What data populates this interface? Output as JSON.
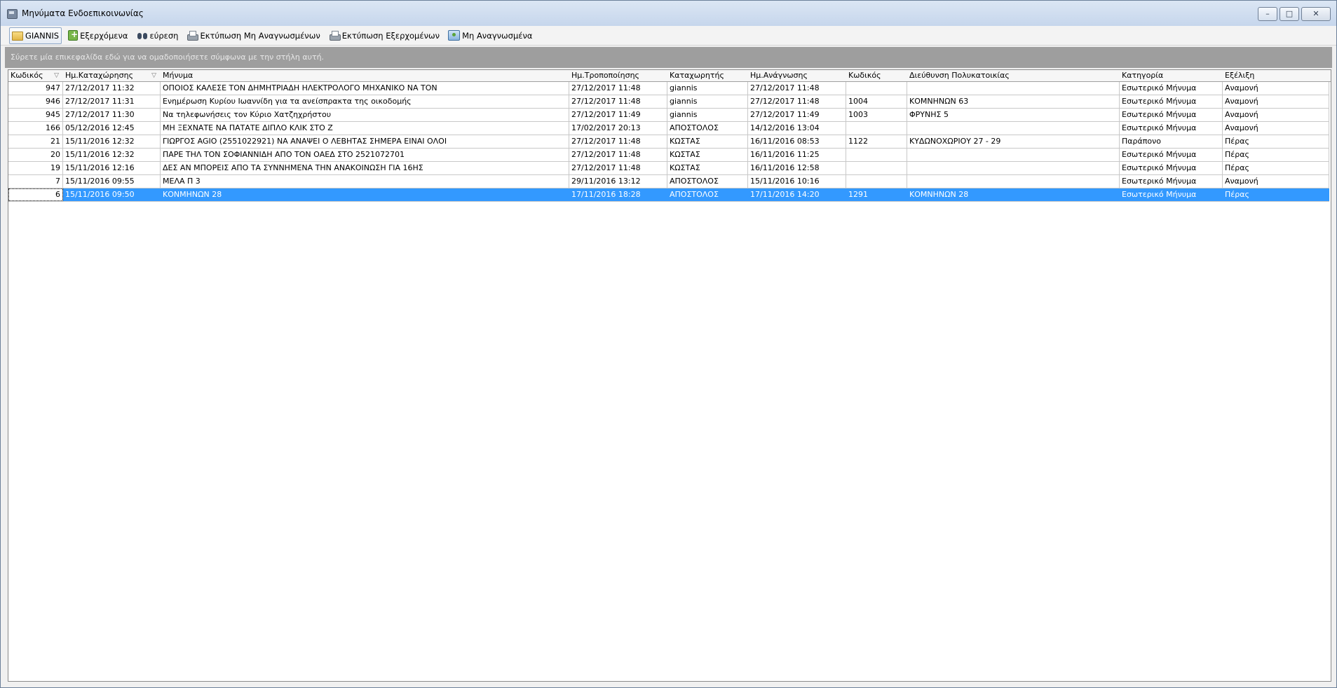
{
  "window": {
    "title": "Μηνύματα Ενδοεπικοινωνίας",
    "controls": {
      "minimize": "–",
      "maximize": "□",
      "close": "✕"
    }
  },
  "toolbar": {
    "items": [
      {
        "label": "GIANNIS",
        "icon": "folder-icon"
      },
      {
        "label": "Εξερχόμενα",
        "icon": "export-icon"
      },
      {
        "label": "εύρεση",
        "icon": "binoculars-icon"
      },
      {
        "label": "Εκτύπωση Μη Αναγνωσμένων",
        "icon": "printer-icon"
      },
      {
        "label": "Εκτύπωση Εξερχομένων",
        "icon": "printer-icon"
      },
      {
        "label": "Μη Αναγνωσμένα",
        "icon": "unread-mail-icon"
      }
    ]
  },
  "groupbar": {
    "text": "Σύρετε μία επικεφαλίδα εδώ για να ομαδοποιήσετε σύμφωνα με την στήλη αυτή."
  },
  "grid": {
    "columns": [
      "Κωδικός",
      "Ημ.Καταχώρησης",
      "Μήνυμα",
      "Ημ.Τροποποίησης",
      "Καταχωρητής",
      "Ημ.Ανάγνωσης",
      "Κωδικός",
      "Διεύθυνση Πολυκατοικίας",
      "Κατηγορία",
      "Εξέλιξη"
    ],
    "filter_icon": "▽",
    "rows": [
      [
        "947",
        "27/12/2017 11:32",
        "ΟΠΟΙΟΣ ΚΑΛΕΣΕ ΤΟΝ ΔΗΜΗΤΡΙΑΔΗ ΗΛΕΚΤΡΟΛΟΓΟ ΜΗΧΑΝΙΚΟ ΝΑ ΤΟΝ",
        "27/12/2017 11:48",
        "giannis",
        "27/12/2017 11:48",
        "",
        "",
        "Εσωτερικό Μήνυμα",
        "Αναμονή"
      ],
      [
        "946",
        "27/12/2017 11:31",
        "Ενημέρωση Κυρίου Ιωαννίδη για τα ανείσπρακτα της οικοδομής",
        "27/12/2017 11:48",
        "giannis",
        "27/12/2017 11:48",
        "1004",
        "ΚΟΜΝΗΝΩΝ 63",
        "Εσωτερικό Μήνυμα",
        "Αναμονή"
      ],
      [
        "945",
        "27/12/2017 11:30",
        "Να τηλεφωνήσεις τον Κύριο Χατζηχρήστου",
        "27/12/2017 11:49",
        "giannis",
        "27/12/2017 11:49",
        "1003",
        "ΦΡΥΝΗΣ 5",
        "Εσωτερικό Μήνυμα",
        "Αναμονή"
      ],
      [
        "166",
        "05/12/2016 12:45",
        "ΜΗ ΞΕΧΝΑΤΕ ΝΑ ΠΑΤΑΤΕ ΔΙΠΛΟ ΚΛΙΚ ΣΤΟ Ζ",
        "17/02/2017 20:13",
        "ΑΠΟΣΤΟΛΟΣ",
        "14/12/2016 13:04",
        "",
        "",
        "Εσωτερικό Μήνυμα",
        "Αναμονή"
      ],
      [
        "21",
        "15/11/2016 12:32",
        "ΓΙΩΡΓΟΣ AGIO (2551022921) ΝΑ ΑΝΑΨΕΙ Ο ΛΕΒΗΤΑΣ ΣΗΜΕΡΑ ΕΙΝΑΙ ΟΛΟΙ",
        "27/12/2017 11:48",
        "ΚΩΣΤΑΣ",
        "16/11/2016 08:53",
        "1122",
        "ΚΥΔΩΝΟΧΩΡΙΟΥ   27 - 29",
        "Παράπονο",
        "Πέρας"
      ],
      [
        "20",
        "15/11/2016 12:32",
        "ΠΑΡΕ ΤΗΛ ΤΟΝ ΣΟΦΙΑΝΝΙΔΗ ΑΠΟ ΤΟΝ ΟΑΕΔ ΣΤΟ 2521072701",
        "27/12/2017 11:48",
        "ΚΩΣΤΑΣ",
        "16/11/2016 11:25",
        "",
        "",
        "Εσωτερικό Μήνυμα",
        "Πέρας"
      ],
      [
        "19",
        "15/11/2016 12:16",
        "ΔΕΣ ΑΝ ΜΠΟΡΕΙΣ ΑΠΟ ΤΑ ΣΥΝΝΗΜΕΝΑ ΤΗΝ ΑΝΑΚΟΙΝΩΣΗ ΓΙΑ 16ΗΣ",
        "27/12/2017 11:48",
        "ΚΩΣΤΑΣ",
        "16/11/2016 12:58",
        "",
        "",
        "Εσωτερικό Μήνυμα",
        "Πέρας"
      ],
      [
        "7",
        "15/11/2016 09:55",
        "ΜΕΛΑ Π 3",
        "29/11/2016 13:12",
        "ΑΠΟΣΤΟΛΟΣ",
        "15/11/2016 10:16",
        "",
        "",
        "Εσωτερικό Μήνυμα",
        "Αναμονή"
      ],
      [
        "6",
        "15/11/2016 09:50",
        "ΚΟΝΜΗΝΩΝ 28",
        "17/11/2016 18:28",
        "ΑΠΟΣΤΟΛΟΣ",
        "17/11/2016 14:20",
        "1291",
        "ΚΟΜΝΗΝΩΝ 28",
        "Εσωτερικό Μήνυμα",
        "Πέρας"
      ]
    ],
    "selected_row": 8
  }
}
